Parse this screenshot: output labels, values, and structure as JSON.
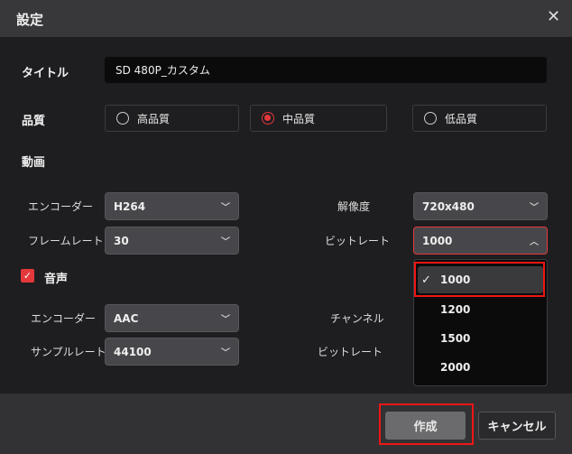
{
  "dialog": {
    "title": "設定"
  },
  "title_field": {
    "label": "タイトル",
    "value": "SD 480P_カスタム"
  },
  "quality": {
    "label": "品質",
    "options": [
      "高品質",
      "中品質",
      "低品質"
    ],
    "selected": "中品質"
  },
  "video": {
    "section": "動画",
    "encoder_label": "エンコーダー",
    "encoder": "H264",
    "framerate_label": "フレームレート",
    "framerate": "30",
    "resolution_label": "解像度",
    "resolution": "720x480",
    "bitrate_label": "ビットレート",
    "bitrate": "1000"
  },
  "audio": {
    "section": "音声",
    "enabled": true,
    "encoder_label": "エンコーダー",
    "encoder": "AAC",
    "samplerate_label": "サンプルレート",
    "samplerate": "44100",
    "channel_label": "チャンネル",
    "bitrate_label": "ビットレート"
  },
  "bitrate_dropdown": {
    "options": [
      "1000",
      "1200",
      "1500",
      "2000"
    ],
    "selected": "1000"
  },
  "footer": {
    "create": "作成",
    "cancel": "キャンセル"
  },
  "colors": {
    "accent": "#e5383b",
    "highlight": "#f01515"
  }
}
